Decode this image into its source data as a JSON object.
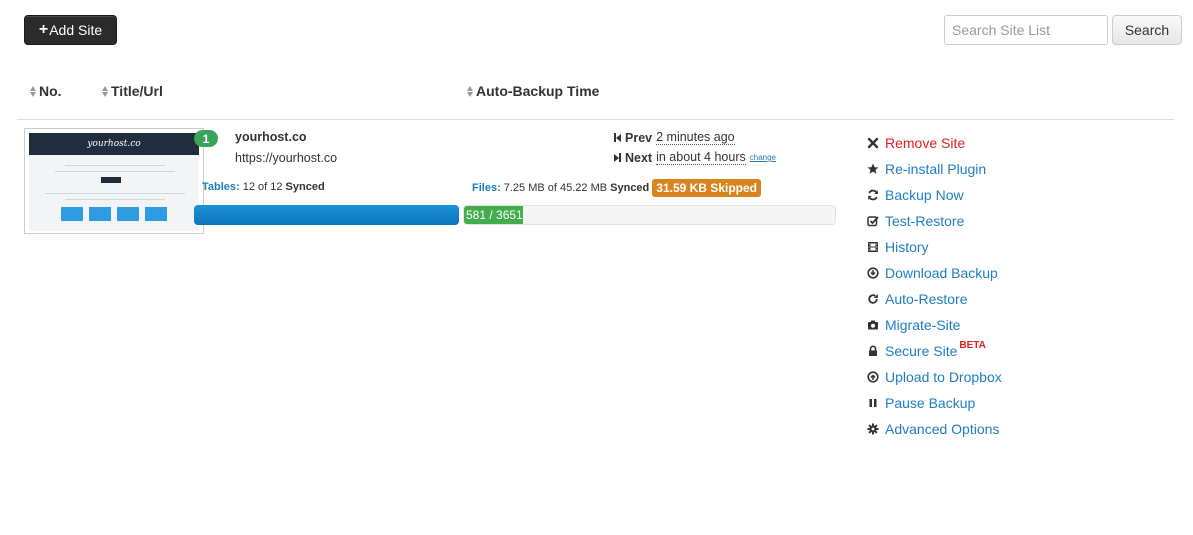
{
  "toolbar": {
    "add_label": "Add Site",
    "add_plus": "+"
  },
  "search": {
    "placeholder": "Search Site List",
    "button_label": "Search"
  },
  "columns": {
    "no": "No.",
    "title": "Title/Url",
    "backup_time": "Auto-Backup Time"
  },
  "site": {
    "thumbnail_logo": "yourhost.co",
    "number": "1",
    "name": "yourhost.co",
    "url": "https://yourhost.co",
    "prev_label": "Prev",
    "prev_value": "2 minutes ago",
    "next_label": "Next",
    "next_value": "in about 4 hours",
    "change_label": "change",
    "tables": {
      "label": "Tables:",
      "text": "12 of 12",
      "status": "Synced",
      "progress": 1.0
    },
    "files": {
      "label": "Files:",
      "text": "7.25 MB of 45.22 MB",
      "status": "Synced",
      "skipped": "31.59 KB Skipped",
      "progress_text": "581 / 3651",
      "progress": 0.159
    }
  },
  "actions": [
    {
      "label": "Remove Site",
      "icon": "close-icon",
      "name": "remove-site",
      "color": "#e02020"
    },
    {
      "label": "Re-install Plugin",
      "icon": "star-icon",
      "name": "reinstall-plugin"
    },
    {
      "label": "Backup Now",
      "icon": "refresh-icon",
      "name": "backup-now"
    },
    {
      "label": "Test-Restore",
      "icon": "check-square-icon",
      "name": "test-restore"
    },
    {
      "label": "History",
      "icon": "film-icon",
      "name": "history"
    },
    {
      "label": "Download Backup",
      "icon": "download-circle-icon",
      "name": "download-backup"
    },
    {
      "label": "Auto-Restore",
      "icon": "repeat-icon",
      "name": "auto-restore"
    },
    {
      "label": "Migrate-Site",
      "icon": "camera-icon",
      "name": "migrate-site"
    },
    {
      "label": "Secure Site",
      "icon": "lock-icon",
      "name": "secure-site",
      "badge": "BETA"
    },
    {
      "label": "Upload to Dropbox",
      "icon": "upload-circle-icon",
      "name": "upload-to-dropbox"
    },
    {
      "label": "Pause Backup",
      "icon": "pause-icon",
      "name": "pause-backup"
    },
    {
      "label": "Advanced Options",
      "icon": "gear-icon",
      "name": "advanced-options"
    }
  ],
  "colors": {
    "link": "#1f7ec2",
    "danger": "#e02020",
    "success": "#43ad4e",
    "primary": "#0b74bd",
    "warning": "#d9841f",
    "badge_green": "#3aa45b"
  }
}
